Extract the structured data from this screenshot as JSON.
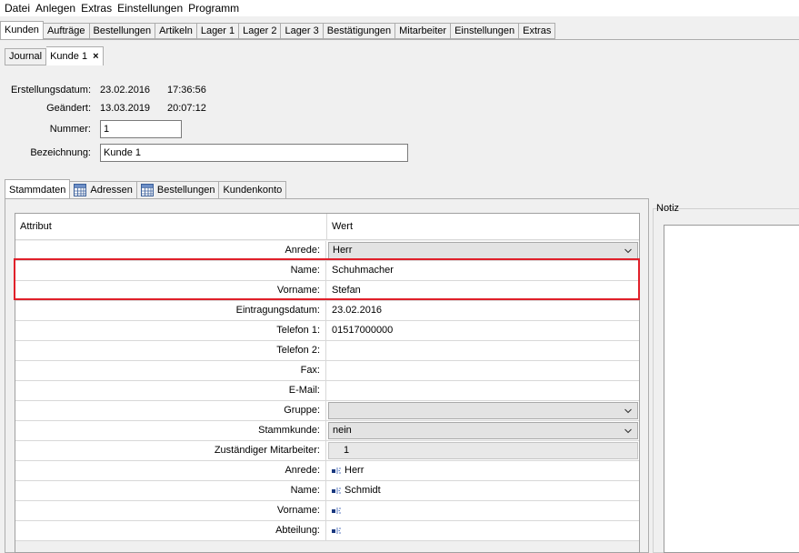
{
  "menu": [
    "Datei",
    "Anlegen",
    "Extras",
    "Einstellungen",
    "Programm"
  ],
  "main_tabs": [
    "Kunden",
    "Aufträge",
    "Bestellungen",
    "Artikeln",
    "Lager 1",
    "Lager 2",
    "Lager 3",
    "Bestätigungen",
    "Mitarbeiter",
    "Einstellungen",
    "Extras"
  ],
  "sub_tabs": {
    "journal": "Journal",
    "kunde": "Kunde 1",
    "close": "×"
  },
  "header": {
    "erstellungsdatum_label": "Erstellungsdatum:",
    "erstellungsdatum_date": "23.02.2016",
    "erstellungsdatum_time": "17:36:56",
    "geaendert_label": "Geändert:",
    "geaendert_date": "13.03.2019",
    "geaendert_time": "20:07:12",
    "nummer_label": "Nummer:",
    "nummer_value": "1",
    "bezeichnung_label": "Bezeichnung:",
    "bezeichnung_value": "Kunde 1"
  },
  "detail_tabs": [
    {
      "label": "Stammdaten",
      "icon": ""
    },
    {
      "label": "Adressen",
      "icon": "grid-icon"
    },
    {
      "label": "Bestellungen",
      "icon": "grid-icon"
    },
    {
      "label": "Kundenkonto",
      "icon": ""
    }
  ],
  "table": {
    "col_attribut": "Attribut",
    "col_wert": "Wert",
    "rows": [
      {
        "label": "Anrede:",
        "value": "Herr",
        "kind": "combo"
      },
      {
        "label": "Name:",
        "value": "Schuhmacher",
        "kind": "text"
      },
      {
        "label": "Vorname:",
        "value": "Stefan",
        "kind": "text"
      },
      {
        "label": "Eintragungsdatum:",
        "value": "23.02.2016",
        "kind": "text"
      },
      {
        "label": "Telefon 1:",
        "value": "01517000000",
        "kind": "text"
      },
      {
        "label": "Telefon 2:",
        "value": "",
        "kind": "text"
      },
      {
        "label": "Fax:",
        "value": "",
        "kind": "text"
      },
      {
        "label": "E-Mail:",
        "value": "",
        "kind": "text"
      },
      {
        "label": "Gruppe:",
        "value": "",
        "kind": "combo"
      },
      {
        "label": "Stammkunde:",
        "value": "nein",
        "kind": "combo"
      },
      {
        "label": "Zuständiger Mitarbeiter:",
        "value": "1",
        "kind": "readonly"
      },
      {
        "label": "Anrede:",
        "value": "Herr",
        "kind": "linked"
      },
      {
        "label": "Name:",
        "value": "Schmidt",
        "kind": "linked"
      },
      {
        "label": "Vorname:",
        "value": "",
        "kind": "linked"
      },
      {
        "label": "Abteilung:",
        "value": "",
        "kind": "linked"
      }
    ]
  },
  "notiz_label": "Notiz",
  "colors": {
    "highlight": "#e0202a"
  }
}
